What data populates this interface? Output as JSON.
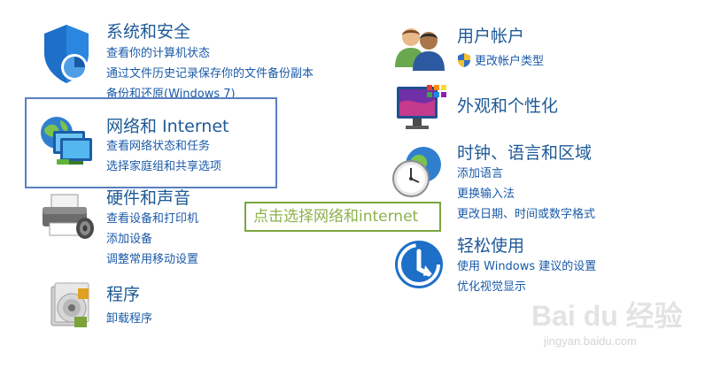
{
  "categories": {
    "system": {
      "title": "系统和安全",
      "links": [
        "查看你的计算机状态",
        "通过文件历史记录保存你的文件备份副本",
        "备份和还原(Windows 7)"
      ]
    },
    "network": {
      "title": "网络和 Internet",
      "links": [
        "查看网络状态和任务",
        "选择家庭组和共享选项"
      ]
    },
    "hardware": {
      "title": "硬件和声音",
      "links": [
        "查看设备和打印机",
        "添加设备",
        "调整常用移动设置"
      ]
    },
    "programs": {
      "title": "程序",
      "links": [
        "卸载程序"
      ]
    },
    "users": {
      "title": "用户帐户",
      "links": [
        "更改帐户类型"
      ]
    },
    "appearance": {
      "title": "外观和个性化",
      "links": []
    },
    "clock": {
      "title": "时钟、语言和区域",
      "links": [
        "添加语言",
        "更换输入法",
        "更改日期、时间或数字格式"
      ]
    },
    "ease": {
      "title": "轻松使用",
      "links": [
        "使用 Windows 建议的设置",
        "优化视觉显示"
      ]
    }
  },
  "annotation": "点击选择网络和internet",
  "watermark": {
    "main": "Bai du 经验",
    "sub": "jingyan.baidu.com"
  },
  "colors": {
    "title": "#1e5a96",
    "link": "#1a5aa8",
    "highlight_border": "#5a7fbf",
    "annotation_border": "#7aa63f",
    "annotation_text": "#8cb24a"
  }
}
